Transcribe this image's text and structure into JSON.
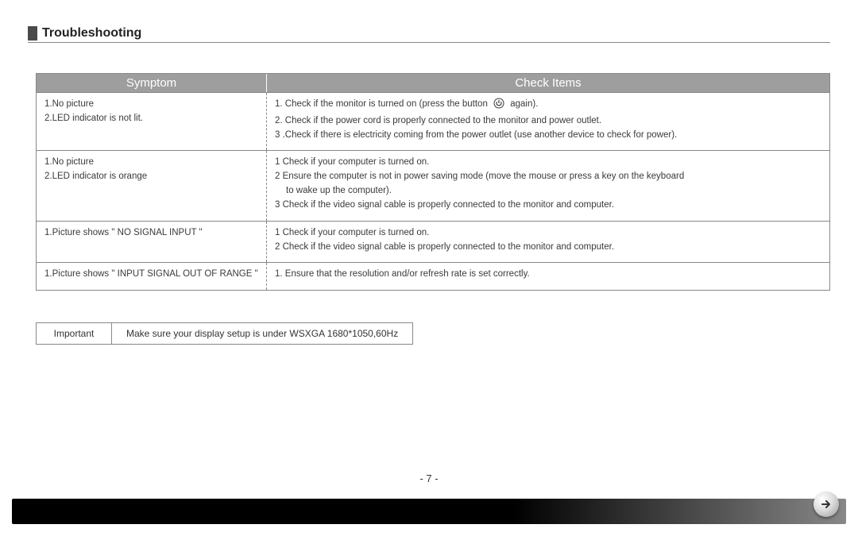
{
  "title": "Troubleshooting",
  "table": {
    "headers": {
      "symptom": "Symptom",
      "check": "Check Items"
    },
    "rows": [
      {
        "symptom": [
          "1.No picture",
          "2.LED indicator is not lit."
        ],
        "check": [
          "1. Check if the monitor is turned on (press the button",
          " again).",
          "2. Check if the power cord is properly connected to the monitor and power outlet.",
          "3 .Check if there is electricity coming from the power outlet (use another device to check for power)."
        ],
        "has_power_icon": true
      },
      {
        "symptom": [
          "1.No picture",
          "2.LED indicator is orange"
        ],
        "check": [
          "1 Check if your computer is turned on.",
          "2 Ensure the computer is not in power saving mode (move the mouse or press a key on the keyboard",
          "   to wake up the computer).",
          "3 Check if the video signal cable is properly connected to the monitor and computer."
        ]
      },
      {
        "symptom": [
          "1.Picture shows \" NO SIGNAL INPUT \""
        ],
        "check": [
          "1 Check if your computer is turned on.",
          "2 Check if the video signal cable is properly connected to the monitor and computer."
        ]
      },
      {
        "symptom": [
          "1.Picture shows \" INPUT SIGNAL OUT OF RANGE \""
        ],
        "check": [
          "1. Ensure that the resolution and/or refresh rate is set correctly."
        ]
      }
    ]
  },
  "important": {
    "label": "Important",
    "text": "Make sure your display setup is under WSXGA 1680*1050,60Hz"
  },
  "page_number": "- 7 -"
}
